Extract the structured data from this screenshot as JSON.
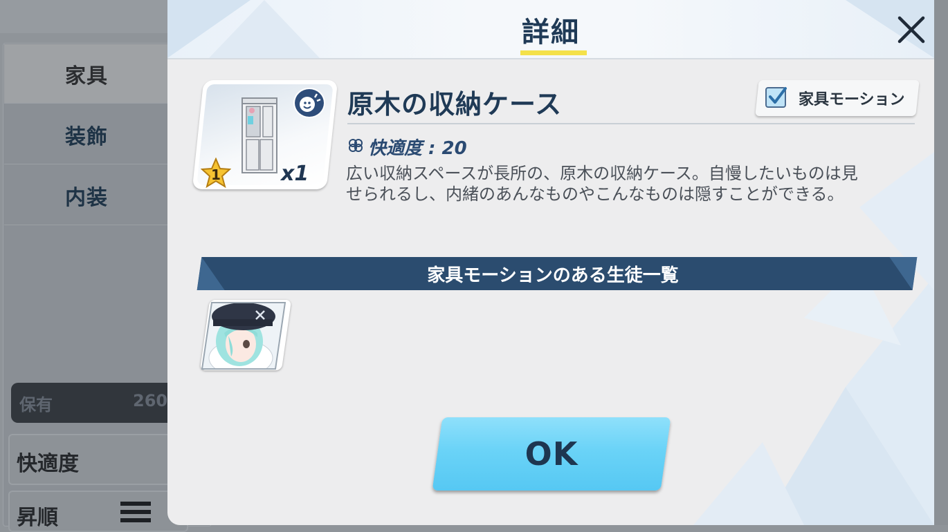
{
  "background": {
    "categories": [
      {
        "label": "家具",
        "active": true
      },
      {
        "label": "装飾",
        "active": false
      },
      {
        "label": "内装",
        "active": false
      }
    ],
    "owned_label": "保有",
    "owned_value": "260",
    "sort_label": "快適度",
    "order_label": "昇順"
  },
  "modal": {
    "title": "詳細",
    "close_icon": "close-icon",
    "item": {
      "name": "原木の収納ケース",
      "quantity": "x1",
      "rarity": "1",
      "comfort": "快適度 : 20",
      "description_line1": "広い収納スペースが長所の、原木の収納ケース。自慢したいものは見",
      "description_line2": "せられるし、内緒のあんなものやこんなものは隠すことができる。"
    },
    "motion_toggle": {
      "label": "家具モーション",
      "checked": true
    },
    "section_title": "家具モーションのある生徒一覧",
    "students": [
      {
        "icon": "student-portrait"
      }
    ],
    "ok_label": "OK"
  },
  "colors": {
    "title": "#1f3a56",
    "accent_underline": "#f4e14a",
    "section_bar": "#2b4c6f",
    "ok_button": "#6ad3f7"
  }
}
